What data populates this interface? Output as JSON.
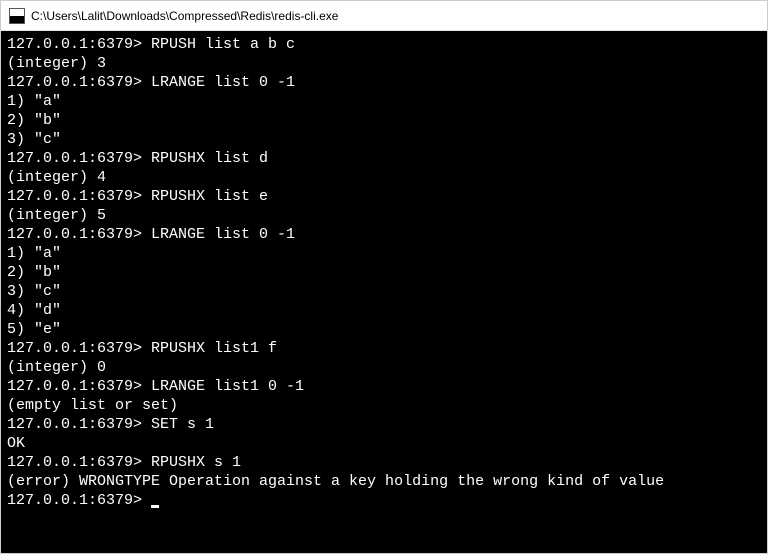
{
  "titlebar": {
    "path": "C:\\Users\\Lalit\\Downloads\\Compressed\\Redis\\redis-cli.exe"
  },
  "prompt": "127.0.0.1:6379>",
  "lines": [
    {
      "type": "cmd",
      "text": "RPUSH list a b c"
    },
    {
      "type": "out",
      "text": "(integer) 3"
    },
    {
      "type": "cmd",
      "text": "LRANGE list 0 -1"
    },
    {
      "type": "out",
      "text": "1) \"a\""
    },
    {
      "type": "out",
      "text": "2) \"b\""
    },
    {
      "type": "out",
      "text": "3) \"c\""
    },
    {
      "type": "cmd",
      "text": "RPUSHX list d"
    },
    {
      "type": "out",
      "text": "(integer) 4"
    },
    {
      "type": "cmd",
      "text": "RPUSHX list e"
    },
    {
      "type": "out",
      "text": "(integer) 5"
    },
    {
      "type": "cmd",
      "text": "LRANGE list 0 -1"
    },
    {
      "type": "out",
      "text": "1) \"a\""
    },
    {
      "type": "out",
      "text": "2) \"b\""
    },
    {
      "type": "out",
      "text": "3) \"c\""
    },
    {
      "type": "out",
      "text": "4) \"d\""
    },
    {
      "type": "out",
      "text": "5) \"e\""
    },
    {
      "type": "cmd",
      "text": "RPUSHX list1 f"
    },
    {
      "type": "out",
      "text": "(integer) 0"
    },
    {
      "type": "cmd",
      "text": "LRANGE list1 0 -1"
    },
    {
      "type": "out",
      "text": "(empty list or set)"
    },
    {
      "type": "cmd",
      "text": "SET s 1"
    },
    {
      "type": "out",
      "text": "OK"
    },
    {
      "type": "cmd",
      "text": "RPUSHX s 1"
    },
    {
      "type": "out",
      "text": "(error) WRONGTYPE Operation against a key holding the wrong kind of value"
    },
    {
      "type": "cmd",
      "text": "",
      "cursor": true
    }
  ]
}
